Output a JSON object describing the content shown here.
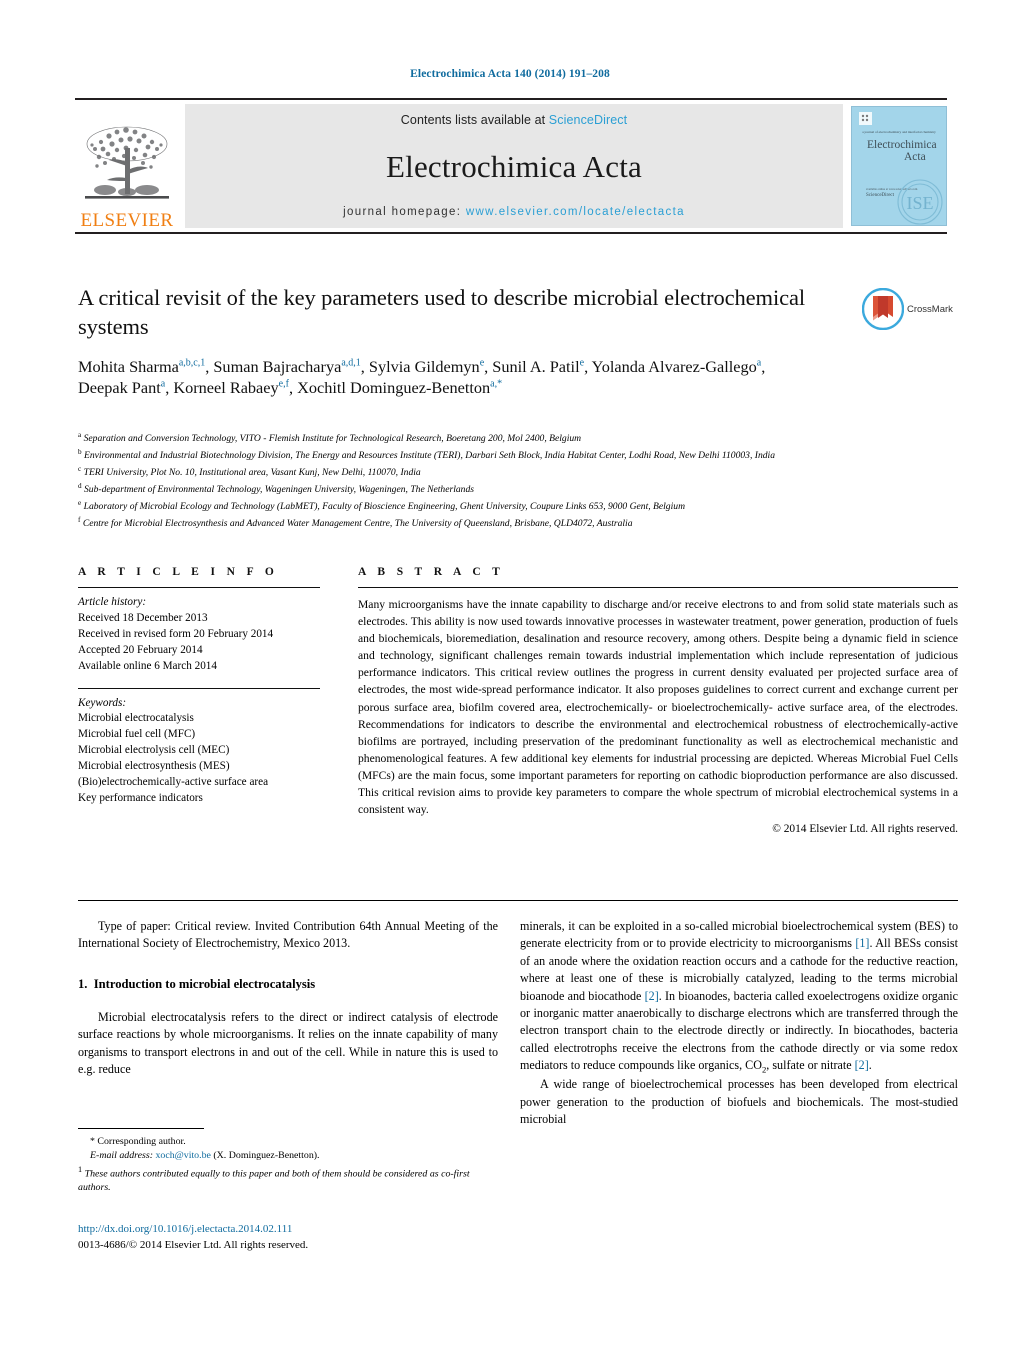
{
  "running_head": "Electrochimica Acta 140 (2014) 191–208",
  "masthead": {
    "contents_prefix": "Contents lists available at ",
    "contents_link": "ScienceDirect",
    "journal_title": "Electrochimica Acta",
    "homepage_prefix": "journal homepage: ",
    "homepage_link": "www.elsevier.com/locate/electacta",
    "publisher_wordmark": "ELSEVIER",
    "cover_title_line1": "Electrochimica",
    "cover_title_line2": "Acta",
    "cover_top_caption": "a material and analytical chemistry",
    "cover_bottom_caption": "ScienceDirect"
  },
  "crossmark": {
    "label": "CrossMark"
  },
  "title": "A critical revisit of the key parameters used to describe microbial electrochemical systems",
  "authors_html": "Mohita Sharma<sup>a,b,c,1</sup>, Suman Bajracharya<sup>a,d,1</sup>, Sylvia Gildemyn<sup>e</sup>, Sunil A. Patil<sup>e</sup>, Yolanda Alvarez-Gallego<sup>a</sup>, Deepak Pant<sup>a</sup>, Korneel Rabaey<sup>e,f</sup>, Xochitl Dominguez-Benetton<sup>a,*</sup>",
  "affiliations": [
    {
      "mark": "a",
      "text": "Separation and Conversion Technology, VITO - Flemish Institute for Technological Research, Boeretang 200, Mol 2400, Belgium"
    },
    {
      "mark": "b",
      "text": "Environmental and Industrial Biotechnology Division, The Energy and Resources Institute (TERI), Darbari Seth Block, India Habitat Center, Lodhi Road, New Delhi 110003, India"
    },
    {
      "mark": "c",
      "text": "TERI University, Plot No. 10, Institutional area, Vasant Kunj, New Delhi, 110070, India"
    },
    {
      "mark": "d",
      "text": "Sub-department of Environmental Technology, Wageningen University, Wageningen, The Netherlands"
    },
    {
      "mark": "e",
      "text": "Laboratory of Microbial Ecology and Technology (LabMET), Faculty of Bioscience Engineering, Ghent University, Coupure Links 653, 9000 Gent, Belgium"
    },
    {
      "mark": "f",
      "text": "Centre for Microbial Electrosynthesis and Advanced Water Management Centre, The University of Queensland, Brisbane, QLD4072, Australia"
    }
  ],
  "article_info": {
    "heading": "A R T I C L E   I N F O",
    "history_label": "Article history:",
    "history": [
      "Received 18 December 2013",
      "Received in revised form 20 February 2014",
      "Accepted 20 February 2014",
      "Available online 6 March 2014"
    ],
    "keywords_label": "Keywords:",
    "keywords": [
      "Microbial electrocatalysis",
      "Microbial fuel cell (MFC)",
      "Microbial electrolysis cell (MEC)",
      "Microbial electrosynthesis (MES)",
      "(Bio)electrochemically-active surface area",
      "Key performance indicators"
    ]
  },
  "abstract": {
    "heading": "A B S T R A C T",
    "text": "Many microorganisms have the innate capability to discharge and/or receive electrons to and from solid state materials such as electrodes. This ability is now used towards innovative processes in wastewater treatment, power generation, production of fuels and biochemicals, bioremediation, desalination and resource recovery, among others. Despite being a dynamic field in science and technology, significant challenges remain towards industrial implementation which include representation of judicious performance indicators. This critical review outlines the progress in current density evaluated per projected surface area of electrodes, the most wide-spread performance indicator. It also proposes guidelines to correct current and exchange current per porous surface area, biofilm covered area, electrochemically- or bioelectrochemically- active surface area, of the electrodes. Recommendations for indicators to describe the environmental and electrochemical robustness of electrochemically-active biofilms are portrayed, including preservation of the predominant functionality as well as electrochemical mechanistic and phenomenological features. A few additional key elements for industrial processing are depicted. Whereas Microbial Fuel Cells (MFCs) are the main focus, some important parameters for reporting on cathodic bioproduction performance are also discussed. This critical revision aims to provide key parameters to compare the whole spectrum of microbial electrochemical systems in a consistent way.",
    "copyright": "© 2014 Elsevier Ltd. All rights reserved."
  },
  "body": {
    "left": {
      "type_of_paper": "Type of paper: Critical review. Invited Contribution 64th Annual Meeting of the International Society of Electrochemistry, Mexico 2013.",
      "section_number": "1.",
      "section_title": "Introduction to microbial electrocatalysis",
      "paragraph1": "Microbial electrocatalysis refers to the direct or indirect catalysis of electrode surface reactions by whole microorganisms. It relies on the innate capability of many organisms to transport electrons in and out of the cell. While in nature this is used to e.g. reduce"
    },
    "right": {
      "paragraph1_a": "minerals, it can be exploited in a so-called microbial bioelectrochemical system (BES) to generate electricity from or to provide electricity to microorganisms ",
      "ref1": "[1]",
      "paragraph1_b": ". All BESs consist of an anode where the oxidation reaction occurs and a cathode for the reductive reaction, where at least one of these is microbially catalyzed, leading to the terms microbial bioanode and biocathode ",
      "ref2": "[2]",
      "paragraph1_c": ". In bioanodes, bacteria called exoelectrogens oxidize organic or inorganic matter anaerobically to discharge electrons which are transferred through the electron transport chain to the electrode directly or indirectly. In biocathodes, bacteria called electrotrophs receive the electrons from the cathode directly or via some redox mediators to reduce compounds like organics, CO",
      "co2_sub": "2",
      "paragraph1_d": ", sulfate or nitrate ",
      "ref3": "[2]",
      "paragraph1_e": ".",
      "paragraph2": "A wide range of bioelectrochemical processes has been developed from electrical power generation to the production of biofuels and biochemicals. The most-studied microbial"
    }
  },
  "footnotes": {
    "corresponding_mark": "*",
    "corresponding_text": "Corresponding author.",
    "email_label": "E-mail address:",
    "email": "xoch@vito.be",
    "email_suffix": "(X. Dominguez-Benetton).",
    "fn1_mark": "1",
    "fn1_text": "These authors contributed equally to this paper and both of them should be considered as co-first authors."
  },
  "footer": {
    "doi": "http://dx.doi.org/10.1016/j.electacta.2014.02.111",
    "issn": "0013-4686/© 2014 Elsevier Ltd. All rights reserved."
  },
  "colors": {
    "link_blue": "#0f6b9e",
    "science_direct_blue": "#2b9fd4",
    "elsevier_orange": "#f07f13",
    "band_gray": "#e7e7e7",
    "cover_blue": "#9fd3ea"
  }
}
